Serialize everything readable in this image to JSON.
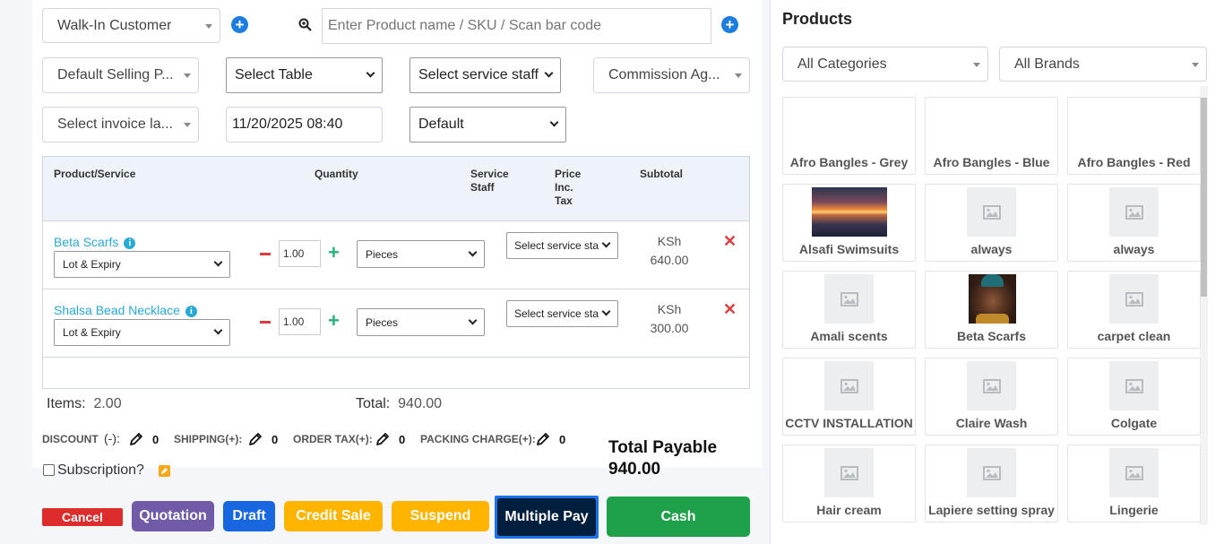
{
  "customer": {
    "value": "Walk-In Customer"
  },
  "search": {
    "placeholder": "Enter Product name / SKU / Scan bar code"
  },
  "selects": {
    "selling_price": "Default Selling P...",
    "table": "Select Table",
    "service_staff": "Select service staff",
    "commission_agent": "Commission Ag...",
    "invoice_layout": "Select invoice la...",
    "datetime": "11/20/2025 08:40",
    "invoice_scheme": "Default"
  },
  "table": {
    "headers": {
      "product": "Product/Service",
      "quantity": "Quantity",
      "service_staff": "Service Staff",
      "price": "Price Inc. Tax",
      "subtotal": "Subtotal"
    },
    "rows": [
      {
        "name": "Beta Scarfs",
        "lot": "Lot & Expiry",
        "qty": "1.00",
        "unit": "Pieces",
        "staff": "Select service sta",
        "currency": "KSh",
        "subtotal": "640.00"
      },
      {
        "name": "Shalsa Bead Necklace",
        "lot": "Lot & Expiry",
        "qty": "1.00",
        "unit": "Pieces",
        "staff": "Select service sta",
        "currency": "KSh",
        "subtotal": "300.00"
      }
    ]
  },
  "summary": {
    "items_label": "Items:",
    "items_value": "2.00",
    "total_label": "Total:",
    "total_value": "940.00",
    "discount_label": "DISCOUNT",
    "discount_sign": "(-):",
    "discount_value": "0",
    "shipping_label": "SHIPPING(+):",
    "shipping_value": "0",
    "tax_label": "ORDER TAX(+):",
    "tax_value": "0",
    "packing_label": "PACKING CHARGE(+):",
    "packing_value": "0",
    "subscription_label": "Subscription?",
    "total_payable_label": "Total Payable",
    "total_payable_value": "940.00"
  },
  "buttons": {
    "cancel": "Cancel",
    "quotation": "Quotation",
    "draft": "Draft",
    "credit_sale": "Credit Sale",
    "suspend": "Suspend",
    "multiple_pay": "Multiple Pay",
    "cash": "Cash"
  },
  "products_panel": {
    "title": "Products",
    "category": "All Categories",
    "brand": "All Brands",
    "items": [
      {
        "name": "Afro Bangles - Grey",
        "image": "none"
      },
      {
        "name": "Afro Bangles - Blue",
        "image": "none"
      },
      {
        "name": "Afro Bangles - Red",
        "image": "none"
      },
      {
        "name": "Alsafi Swimsuits",
        "image": "sunset-photo"
      },
      {
        "name": "always",
        "image": "placeholder"
      },
      {
        "name": "always",
        "image": "placeholder"
      },
      {
        "name": "Amali scents",
        "image": "placeholder"
      },
      {
        "name": "Beta Scarfs",
        "image": "portrait-photo"
      },
      {
        "name": "carpet clean",
        "image": "placeholder"
      },
      {
        "name": "CCTV INSTALLATION",
        "image": "placeholder"
      },
      {
        "name": "Claire Wash",
        "image": "placeholder"
      },
      {
        "name": "Colgate",
        "image": "placeholder"
      },
      {
        "name": "Hair cream",
        "image": "placeholder"
      },
      {
        "name": "Lapiere setting spray",
        "image": "placeholder"
      },
      {
        "name": "Lingerie",
        "image": "placeholder"
      }
    ]
  },
  "colors": {
    "cancel": "#dc2c2c",
    "quotation": "#6f5ba7",
    "draft": "#1667e0",
    "credit_sale": "#ffb400",
    "suspend": "#ffb400",
    "multiple_pay": "#001f3f",
    "cash": "#1fa04a",
    "link": "#29a9d6"
  }
}
